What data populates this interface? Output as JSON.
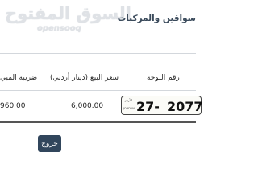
{
  "header": {
    "logo_ar": "السوق المفتوح",
    "logo_en": "opensooq",
    "title": "سواقين والمركبات"
  },
  "table": {
    "columns": {
      "plate": "رقم اللوحة",
      "price": "سعر البيع (دينار أردني)",
      "tax": "ضريبة المبي"
    },
    "row": {
      "plate_country_ar": "الأردن",
      "plate_country_en": "JORDAN",
      "plate_code": "27",
      "plate_separator": "-",
      "plate_number": "2077",
      "price": "6,000.00",
      "tax": "960.00"
    }
  },
  "actions": {
    "exit_label": "خروج"
  }
}
